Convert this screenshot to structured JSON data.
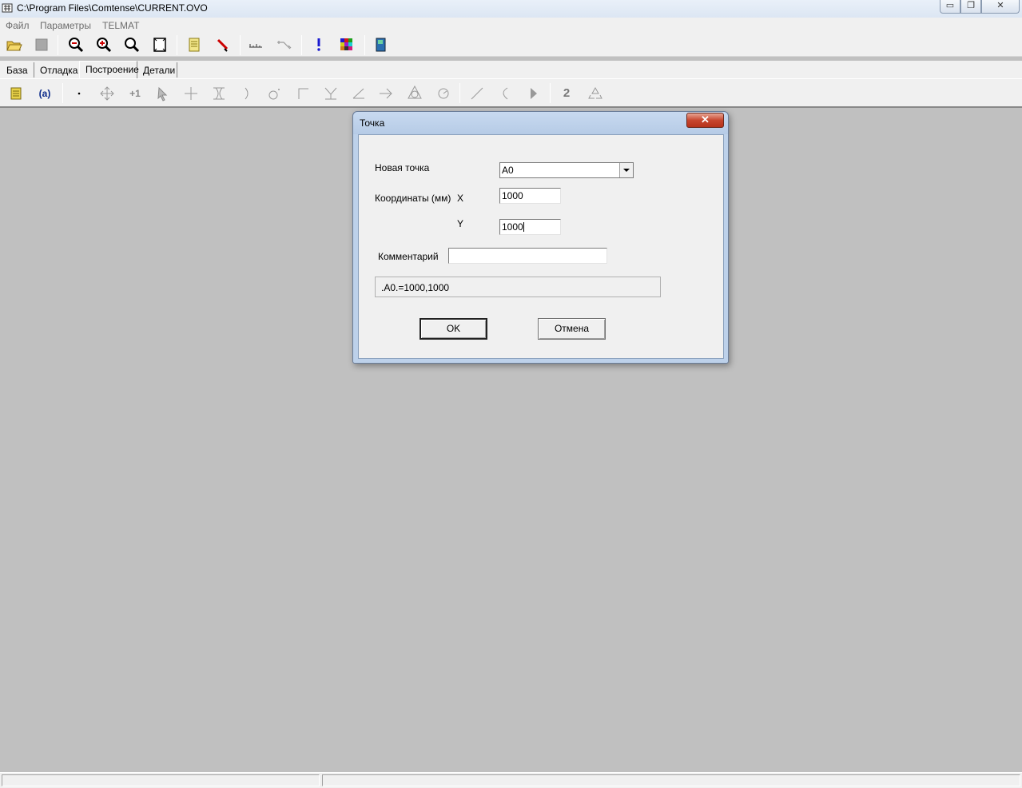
{
  "window": {
    "title": "C:\\Program Files\\Comtense\\CURRENT.OVO",
    "minimize_glyph": "▭",
    "maximize_glyph": "❐",
    "close_glyph": "✕"
  },
  "menu": [
    "Файл",
    "Параметры",
    "TELMAT"
  ],
  "toolbar_top": {
    "icons": [
      "open-folder-icon",
      "stop-icon",
      "zoom-out-icon",
      "zoom-in-icon",
      "zoom-icon",
      "fit-page-icon",
      "notes-icon",
      "pin-icon",
      "ruler-icon",
      "measure-icon",
      "exclamation-icon",
      "palette-icon",
      "book-icon"
    ]
  },
  "tabs": [
    "База",
    "Отладка",
    "Построение",
    "Детали"
  ],
  "active_tab": "Построение",
  "toolbar_construct": {
    "icons": [
      "layers-icon",
      "variable-a-icon",
      "point-icon",
      "move-cross-icon",
      "increment-icon",
      "cursor-icon",
      "plus-icon",
      "bracket-icon",
      "arc-right-icon",
      "circle-point-icon",
      "corner-icon",
      "bisector-icon",
      "angle-icon",
      "arrow-right-icon",
      "triangle-icon",
      "circle-arc-icon",
      "line-icon",
      "curve-icon",
      "play-icon",
      "number-two-icon",
      "recycle-icon"
    ],
    "number_label": "2"
  },
  "dialog": {
    "title": "Точка",
    "close_glyph": "✕",
    "new_point_label": "Новая точка",
    "new_point_value": "A0",
    "coords_label": "Координаты (мм)",
    "x_label": "X",
    "x_value": "1000",
    "y_label": "Y",
    "y_value": "1000",
    "comment_label": "Комментарий",
    "comment_value": "",
    "formula": ".A0.=1000,1000",
    "ok_label": "OK",
    "cancel_label": "Отмена"
  },
  "colors": {
    "workspace": "#c0c0c0",
    "chrome": "#f0f0f0",
    "dialog_frame": "#bdd1ea",
    "close_button": "#c7462e"
  }
}
